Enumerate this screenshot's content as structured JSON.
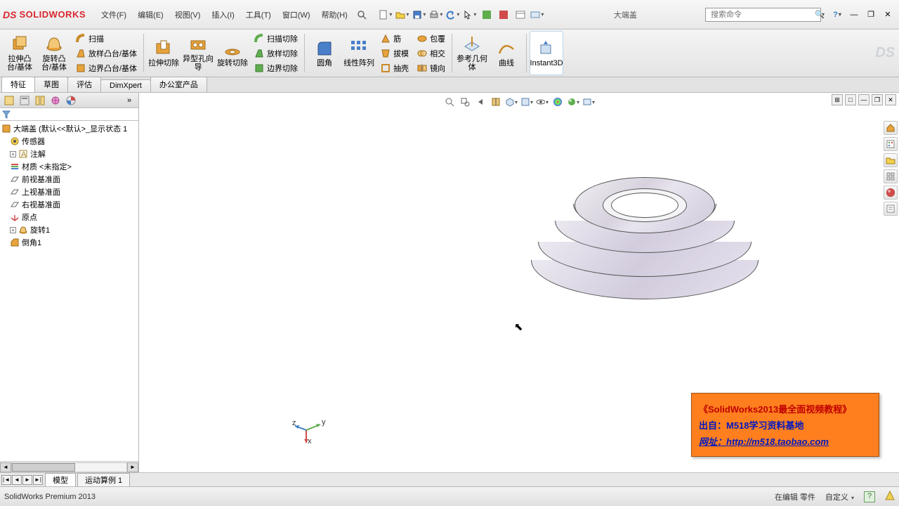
{
  "app": {
    "brand_prefix": "DS",
    "brand": "SOLIDWORKS"
  },
  "menu": {
    "file": "文件(F)",
    "edit": "编辑(E)",
    "view": "视图(V)",
    "insert": "插入(I)",
    "tools": "工具(T)",
    "window": "窗口(W)",
    "help": "帮助(H)"
  },
  "title_doc": "大端盖",
  "search": {
    "placeholder": "搜索命令"
  },
  "ribbon": {
    "extrude": "拉伸凸台/基体",
    "revolve": "旋转凸台/基体",
    "sweep": "扫描",
    "loft": "放样凸台/基体",
    "boundary": "边界凸台/基体",
    "extrude_cut": "拉伸切除",
    "hole_wizard": "异型孔向导",
    "revolve_cut": "旋转切除",
    "sweep_cut": "扫描切除",
    "loft_cut": "放样切除",
    "boundary_cut": "边界切除",
    "fillet": "圆角",
    "pattern": "线性阵列",
    "rib": "筋",
    "draft": "拔模",
    "shell": "抽壳",
    "wrap": "包覆",
    "intersect": "相交",
    "mirror": "镜向",
    "ref_geom": "参考几何体",
    "curves": "曲线",
    "instant3d": "Instant3D"
  },
  "tabs": {
    "features": "特征",
    "sketch": "草图",
    "evaluate": "评估",
    "dimxpert": "DimXpert",
    "office": "办公室产品"
  },
  "tree": {
    "root": "大端盖  (默认<<默认>_显示状态 1",
    "sensors": "传感器",
    "annotations": "注解",
    "material": "材质 <未指定>",
    "front_plane": "前视基准面",
    "top_plane": "上视基准面",
    "right_plane": "右视基准面",
    "origin": "原点",
    "revolve1": "旋转1",
    "chamfer1": "倒角1"
  },
  "bottom_tabs": {
    "model": "模型",
    "motion": "运动算例 1"
  },
  "status": {
    "product": "SolidWorks Premium 2013",
    "edit_state": "在编辑 零件",
    "custom": "自定义"
  },
  "banner": {
    "l1": "《SolidWorks2013最全面视频教程》",
    "l2": "出自：M518学习资料基地",
    "l3": "网址：http://m518.taobao.com"
  }
}
